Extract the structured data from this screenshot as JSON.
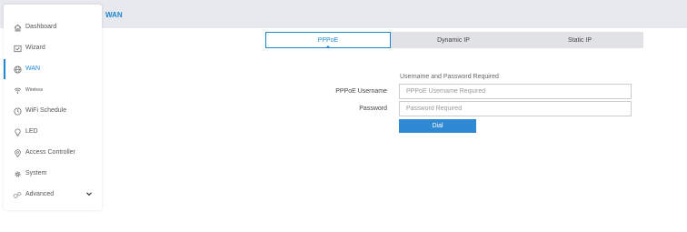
{
  "page": {
    "title": "WAN"
  },
  "sidebar": {
    "items": [
      {
        "label": "Dashboard",
        "icon": "home-icon"
      },
      {
        "label": "Wizard",
        "icon": "wizard-icon"
      },
      {
        "label": "WAN",
        "icon": "globe-icon",
        "active": true
      },
      {
        "label": "Wireless",
        "icon": "wifi-icon"
      },
      {
        "label": "WiFi Schedule",
        "icon": "clock-icon"
      },
      {
        "label": "LED",
        "icon": "bulb-icon"
      },
      {
        "label": "Access Controller",
        "icon": "location-icon"
      },
      {
        "label": "System",
        "icon": "gear-icon"
      },
      {
        "label": "Advanced",
        "icon": "gears-icon",
        "expandable": true
      }
    ]
  },
  "tabs": [
    {
      "label": "PPPoE",
      "active": true
    },
    {
      "label": "Dynamic IP"
    },
    {
      "label": "Static IP"
    }
  ],
  "form": {
    "hint": "Username and Password Required",
    "username_label": "PPPoE Username",
    "username_placeholder": "PPPoE Username Required",
    "username_value": "",
    "password_label": "Password",
    "password_placeholder": "Password Required",
    "password_value": "",
    "dial_label": "Dial"
  },
  "colors": {
    "accent": "#1f88cf",
    "button": "#2f8ad3",
    "topbar": "#e8e9ee",
    "tabbar": "#e1e2e6"
  }
}
